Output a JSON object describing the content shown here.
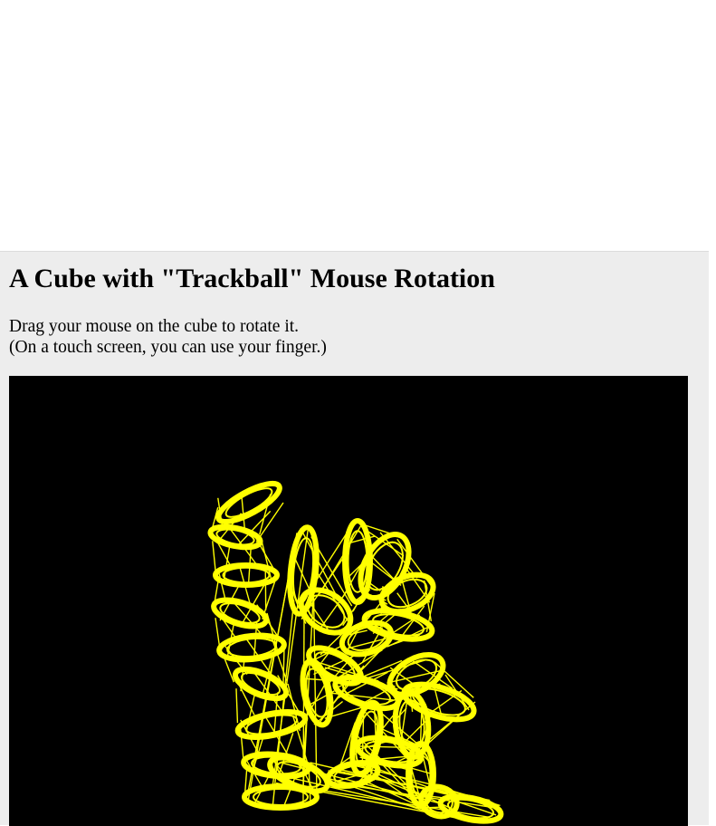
{
  "page": {
    "title": "A Cube with \"Trackball\" Mouse Rotation",
    "instruction_line1": "Drag your mouse on the cube to rotate it.",
    "instruction_line2": "(On a touch screen, you can use your finger.)"
  },
  "canvas": {
    "background": "#000000",
    "stroke_color": "#ffff00"
  },
  "colors": {
    "panel_background": "#ededed",
    "page_background": "#ffffff",
    "text": "#000000"
  }
}
